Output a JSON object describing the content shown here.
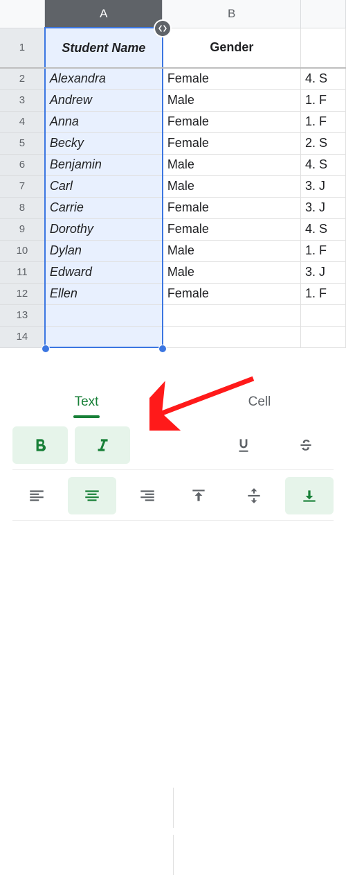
{
  "columns": {
    "A": "A",
    "B": "B"
  },
  "rows": [
    "1",
    "2",
    "3",
    "4",
    "5",
    "6",
    "7",
    "8",
    "9",
    "10",
    "11",
    "12",
    "13",
    "14"
  ],
  "header": {
    "A": "Student Name",
    "B": "Gender"
  },
  "data": [
    {
      "A": "Alexandra",
      "B": "Female",
      "C": "4. S"
    },
    {
      "A": "Andrew",
      "B": "Male",
      "C": "1. F"
    },
    {
      "A": "Anna",
      "B": "Female",
      "C": "1. F"
    },
    {
      "A": "Becky",
      "B": "Female",
      "C": "2. S"
    },
    {
      "A": "Benjamin",
      "B": "Male",
      "C": "4. S"
    },
    {
      "A": "Carl",
      "B": "Male",
      "C": "3. J"
    },
    {
      "A": "Carrie",
      "B": "Female",
      "C": "3. J"
    },
    {
      "A": "Dorothy",
      "B": "Female",
      "C": "4. S"
    },
    {
      "A": "Dylan",
      "B": "Male",
      "C": "1. F"
    },
    {
      "A": "Edward",
      "B": "Male",
      "C": "3. J"
    },
    {
      "A": "Ellen",
      "B": "Female",
      "C": "1. F"
    }
  ],
  "panel": {
    "tabs": {
      "text": "Text",
      "cell": "Cell"
    }
  }
}
